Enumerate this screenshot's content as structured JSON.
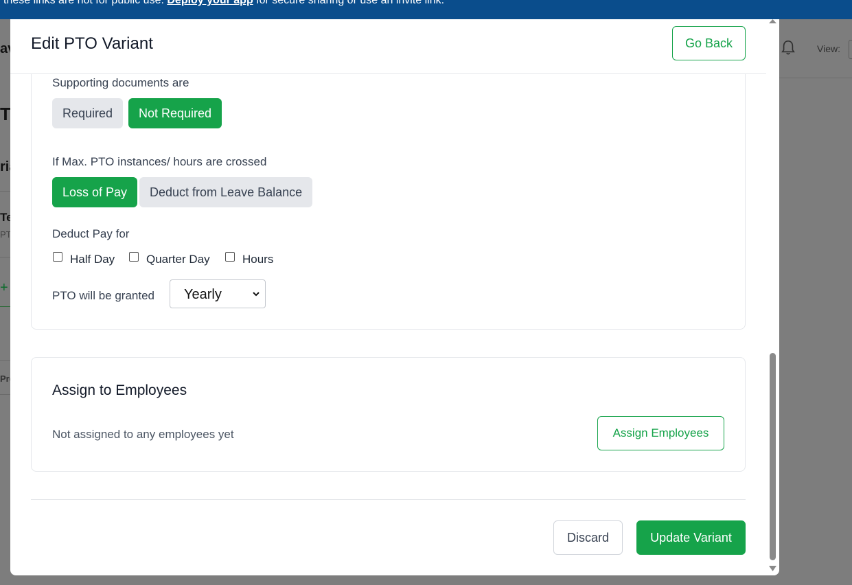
{
  "banner": {
    "text_before": "these links are not for public use. ",
    "link": "Deploy your app",
    "text_after": " for secure sharing or use an invite link."
  },
  "background": {
    "view_label": "View:",
    "fragments": [
      "av",
      "TC",
      "ria",
      "Te",
      "PT",
      "+",
      "Pre"
    ]
  },
  "modal": {
    "title": "Edit PTO Variant",
    "go_back": "Go Back",
    "supporting_docs": {
      "label": "Supporting documents are",
      "options": [
        "Required",
        "Not Required"
      ],
      "selected": "Not Required"
    },
    "max_crossed": {
      "label": "If Max. PTO instances/ hours are crossed",
      "options": [
        "Loss of Pay",
        "Deduct from Leave Balance"
      ],
      "selected": "Loss of Pay"
    },
    "deduct_pay": {
      "label": "Deduct Pay for",
      "options": [
        {
          "label": "Half Day",
          "checked": false
        },
        {
          "label": "Quarter Day",
          "checked": false
        },
        {
          "label": "Hours",
          "checked": false
        }
      ]
    },
    "granted": {
      "label": "PTO will be granted",
      "value": "Yearly"
    },
    "assign": {
      "title": "Assign to Employees",
      "note": "Not assigned to any employees yet",
      "button": "Assign Employees"
    },
    "footer": {
      "discard": "Discard",
      "update": "Update Variant"
    }
  },
  "colors": {
    "accent": "#16a34a",
    "banner": "#0a4d8c",
    "overlay": "#7d7d7d"
  },
  "icons": {
    "bell": "bell-icon",
    "select_arrow": "chevron-down-icon",
    "scroll_up": "scroll-up-arrow-icon",
    "scroll_down": "scroll-down-arrow-icon"
  }
}
